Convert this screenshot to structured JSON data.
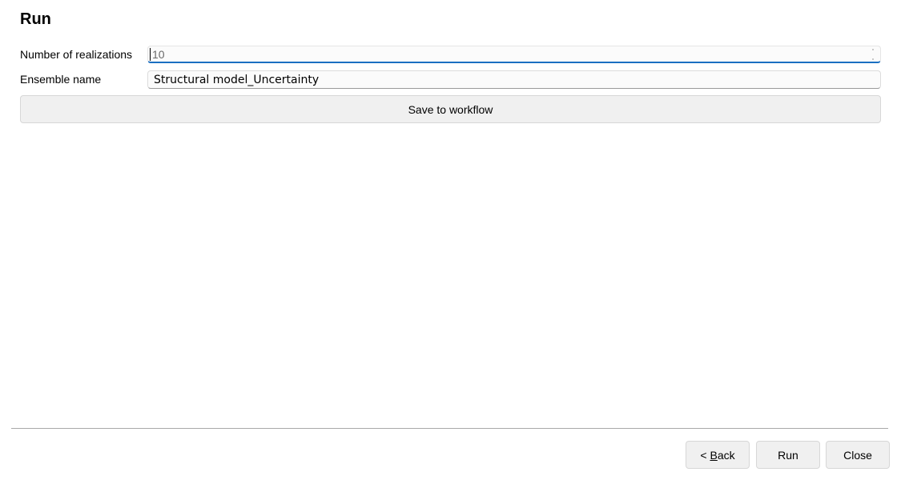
{
  "page": {
    "title": "Run"
  },
  "form": {
    "realizations_label": "Number of realizations",
    "realizations_value": "10",
    "ensemble_label": "Ensemble name",
    "ensemble_value": "Structural model_Uncertainty"
  },
  "buttons": {
    "save_workflow": "Save to workflow",
    "back_prefix": "< ",
    "back_mnemonic": "B",
    "back_rest": "ack",
    "run": "Run",
    "close": "Close"
  },
  "colors": {
    "focus_accent": "#1a6fc2",
    "button_bg": "#f0f0f0"
  }
}
